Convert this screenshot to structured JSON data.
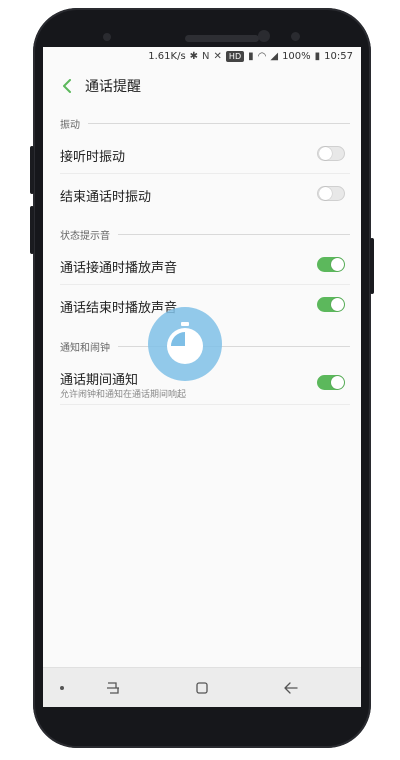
{
  "status_bar": {
    "speed": "1.61K/s",
    "hd": "HD",
    "battery": "100%",
    "time": "10:57"
  },
  "header": {
    "title": "通话提醒"
  },
  "sections": [
    {
      "title": "振动",
      "items": [
        {
          "label": "接听时振动",
          "enabled": false
        },
        {
          "label": "结束通话时振动",
          "enabled": false
        }
      ]
    },
    {
      "title": "状态提示音",
      "items": [
        {
          "label": "通话接通时播放声音",
          "enabled": true
        },
        {
          "label": "通话结束时播放声音",
          "enabled": true
        }
      ]
    },
    {
      "title": "通知和闹钟",
      "items": [
        {
          "label": "通话期间通知",
          "subtitle": "允许闹钟和通知在通话期间响起",
          "enabled": true
        }
      ]
    }
  ],
  "colors": {
    "accent": "#5cb85c",
    "overlay": "#7fbfe6",
    "background": "#fafafa"
  },
  "icons": {
    "back": "chevron-left-icon",
    "overlay": "timer-icon",
    "nav": [
      "dot-icon",
      "recents-icon",
      "home-icon",
      "back-arrow-icon"
    ]
  }
}
